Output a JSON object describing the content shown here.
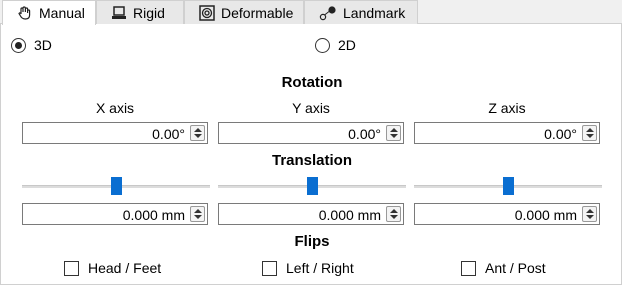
{
  "tabs": [
    {
      "label": "Manual",
      "icon": "hand-icon",
      "active": true
    },
    {
      "label": "Rigid",
      "icon": "monitor-icon",
      "active": false
    },
    {
      "label": "Deformable",
      "icon": "deformable-icon",
      "active": false
    },
    {
      "label": "Landmark",
      "icon": "landmark-icon",
      "active": false
    }
  ],
  "mode": {
    "option_3d": "3D",
    "option_2d": "2D",
    "selected": "3D"
  },
  "rotation": {
    "title": "Rotation",
    "axes": [
      {
        "label": "X axis",
        "value": "0.00°"
      },
      {
        "label": "Y axis",
        "value": "0.00°"
      },
      {
        "label": "Z axis",
        "value": "0.00°"
      }
    ]
  },
  "translation": {
    "title": "Translation",
    "sliders": [
      {
        "position_fraction": 0.5
      },
      {
        "position_fraction": 0.5
      },
      {
        "position_fraction": 0.5
      }
    ],
    "values": [
      "0.000 mm",
      "0.000 mm",
      "0.000 mm"
    ]
  },
  "flips": {
    "title": "Flips",
    "options": [
      {
        "label": "Head / Feet",
        "checked": false
      },
      {
        "label": "Left / Right",
        "checked": false
      },
      {
        "label": "Ant / Post",
        "checked": false
      }
    ]
  },
  "colors": {
    "accent": "#0a6ed1",
    "panel_bg": "#ffffff",
    "window_bg": "#f0f0f0"
  }
}
